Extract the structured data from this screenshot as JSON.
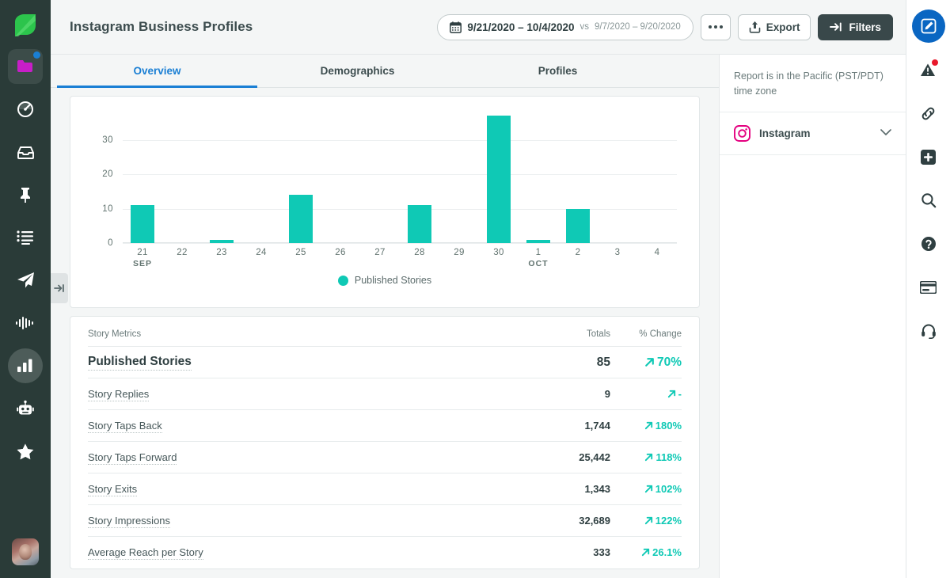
{
  "header": {
    "title": "Instagram Business Profiles",
    "date_range": {
      "primary": "9/21/2020 – 10/4/2020",
      "comparison_prefix": "vs",
      "comparison": "9/7/2020 – 9/20/2020",
      "icon": "calendar-icon"
    },
    "more_button_icon": "ellipsis-icon",
    "export_label": "Export",
    "export_icon": "upload-icon",
    "filters_label": "Filters",
    "filters_icon": "filter-arrow-icon",
    "filters_bg": "#39484a"
  },
  "tabs": [
    {
      "label": "Overview",
      "active": true
    },
    {
      "label": "Demographics",
      "active": false
    },
    {
      "label": "Profiles",
      "active": false
    }
  ],
  "accent": {
    "teal": "#0fc9b5",
    "blue": "#1a7fd4",
    "pink": "#e4007f",
    "dark": "#2a3b38"
  },
  "chart_data": {
    "type": "bar",
    "title": "",
    "xlabel": "",
    "ylabel": "",
    "ylim": [
      0,
      38
    ],
    "yticks": [
      0,
      10,
      20,
      30
    ],
    "grid": true,
    "legend_position": "bottom",
    "categories": [
      "21",
      "22",
      "23",
      "24",
      "25",
      "26",
      "27",
      "28",
      "29",
      "30",
      "1",
      "2",
      "3",
      "4"
    ],
    "category_months": [
      "SEP",
      "",
      "",
      "",
      "",
      "",
      "",
      "",
      "",
      "",
      "OCT",
      "",
      "",
      ""
    ],
    "series": [
      {
        "name": "Published Stories",
        "color": "#0fc9b5",
        "values": [
          11,
          0,
          1,
          0,
          14,
          0,
          0,
          11,
          0,
          37,
          1,
          10,
          0,
          0
        ]
      }
    ]
  },
  "metrics_table": {
    "columns": [
      "Story Metrics",
      "Totals",
      "% Change"
    ],
    "rows": [
      {
        "name": "Published Stories",
        "total": "85",
        "change": "70%",
        "trend": "up",
        "emphasis": true
      },
      {
        "name": "Story Replies",
        "total": "9",
        "change": "-",
        "trend": "up",
        "emphasis": false
      },
      {
        "name": "Story Taps Back",
        "total": "1,744",
        "change": "180%",
        "trend": "up",
        "emphasis": false
      },
      {
        "name": "Story Taps Forward",
        "total": "25,442",
        "change": "118%",
        "trend": "up",
        "emphasis": false
      },
      {
        "name": "Story Exits",
        "total": "1,343",
        "change": "102%",
        "trend": "up",
        "emphasis": false
      },
      {
        "name": "Story Impressions",
        "total": "32,689",
        "change": "122%",
        "trend": "up",
        "emphasis": false
      },
      {
        "name": "Average Reach per Story",
        "total": "333",
        "change": "26.1%",
        "trend": "up",
        "emphasis": false
      }
    ]
  },
  "right_panel": {
    "timezone_note": "Report is in the Pacific (PST/PDT) time zone",
    "profile": {
      "name": "Instagram",
      "icon": "instagram-icon",
      "chevron": "chevron-down-icon"
    }
  },
  "left_rail": {
    "logo_icon": "sprout-leaf-logo",
    "items": [
      {
        "icon": "folder-icon",
        "name": "messages-folder",
        "badge": true,
        "boxed": true,
        "active": false
      },
      {
        "icon": "speedometer-icon",
        "name": "dashboard",
        "badge": false,
        "boxed": false,
        "active": false
      },
      {
        "icon": "inbox-icon",
        "name": "smart-inbox",
        "badge": false,
        "boxed": false,
        "active": false
      },
      {
        "icon": "pin-icon",
        "name": "pinned",
        "badge": false,
        "boxed": false,
        "active": false
      },
      {
        "icon": "list-icon",
        "name": "tasks",
        "badge": false,
        "boxed": false,
        "active": false
      },
      {
        "icon": "paper-plane-icon",
        "name": "publishing",
        "badge": false,
        "boxed": false,
        "active": false
      },
      {
        "icon": "waveform-icon",
        "name": "listening",
        "badge": false,
        "boxed": false,
        "active": false
      },
      {
        "icon": "bar-chart-icon",
        "name": "reports",
        "badge": false,
        "boxed": false,
        "active": true
      },
      {
        "icon": "robot-icon",
        "name": "bots",
        "badge": false,
        "boxed": false,
        "active": false
      },
      {
        "icon": "star-icon",
        "name": "reviews",
        "badge": false,
        "boxed": false,
        "active": false
      }
    ],
    "avatar_name": "user-avatar",
    "collapse_icon": "collapse-arrow-icon"
  },
  "right_rail": {
    "items": [
      {
        "icon": "compose-icon",
        "name": "compose",
        "primary": true,
        "badge": false
      },
      {
        "icon": "alert-icon",
        "name": "alerts",
        "primary": false,
        "badge": true
      },
      {
        "icon": "link-icon",
        "name": "link-shortener",
        "primary": false,
        "badge": false
      },
      {
        "icon": "plus-icon",
        "name": "add",
        "primary": false,
        "badge": false
      },
      {
        "icon": "search-icon",
        "name": "search",
        "primary": false,
        "badge": false
      },
      {
        "icon": "help-icon",
        "name": "help",
        "primary": false,
        "badge": false
      },
      {
        "icon": "card-icon",
        "name": "billing",
        "primary": false,
        "badge": false
      },
      {
        "icon": "headset-icon",
        "name": "support",
        "primary": false,
        "badge": false
      }
    ]
  }
}
